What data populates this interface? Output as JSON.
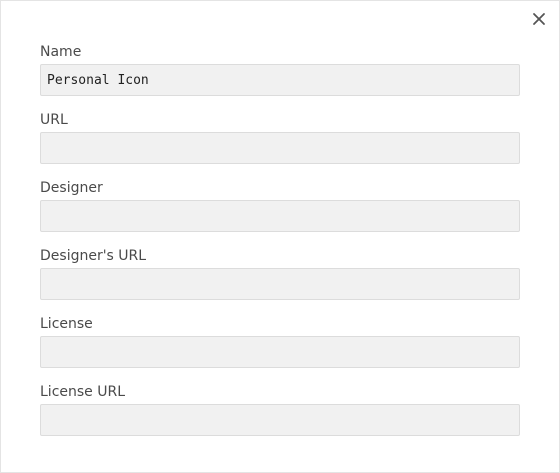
{
  "dialog": {
    "close_icon": "close-icon",
    "fields": [
      {
        "label": "Name",
        "value": "Personal Icon",
        "placeholder": ""
      },
      {
        "label": "URL",
        "value": "",
        "placeholder": ""
      },
      {
        "label": "Designer",
        "value": "",
        "placeholder": ""
      },
      {
        "label": "Designer's URL",
        "value": "",
        "placeholder": ""
      },
      {
        "label": "License",
        "value": "",
        "placeholder": ""
      },
      {
        "label": "License URL",
        "value": "",
        "placeholder": ""
      }
    ]
  }
}
